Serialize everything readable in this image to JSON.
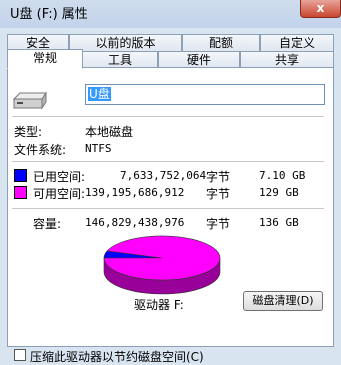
{
  "window": {
    "title": "U盘 (F:) 属性",
    "close_glyph": "x"
  },
  "tabs_row1": [
    "安全",
    "以前的版本",
    "配额",
    "自定义"
  ],
  "tabs_row2": [
    "常规",
    "工具",
    "硬件",
    "共享"
  ],
  "active_tab": "常规",
  "general": {
    "volume_name": "U盘",
    "type_label": "类型:",
    "type_value": "本地磁盘",
    "fs_label": "文件系统:",
    "fs_value": "NTFS",
    "used_label": "已用空间:",
    "used_bytes": "7,633,752,064",
    "used_unit": "字节",
    "used_size": "7.10 GB",
    "used_color": "#0000ff",
    "free_label": "可用空间:",
    "free_bytes": "139,195,686,912",
    "free_unit": "字节",
    "free_size": "129 GB",
    "free_color": "#ff00ff",
    "capacity_label": "容量:",
    "capacity_bytes": "146,829,438,976",
    "capacity_unit": "字节",
    "capacity_size": "136 GB",
    "drive_label": "驱动器 F:",
    "cleanup_button": "磁盘清理(D)",
    "compress_checkbox": "压缩此驱动器以节约磁盘空间(C)"
  },
  "chart_data": {
    "type": "pie",
    "categories": [
      "已用空间",
      "可用空间"
    ],
    "values": [
      7633752064,
      139195686912
    ],
    "colors": [
      "#0000ff",
      "#ff00ff"
    ]
  }
}
